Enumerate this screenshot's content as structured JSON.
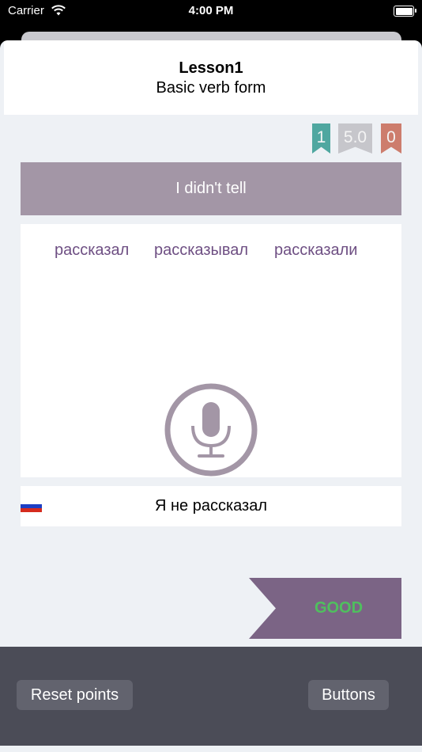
{
  "status_bar": {
    "carrier": "Carrier",
    "time": "4:00 PM"
  },
  "header": {
    "title": "Lesson1",
    "subtitle": "Basic verb form"
  },
  "scores": {
    "correct": "1",
    "rating": "5.0",
    "wrong": "0"
  },
  "prompt": {
    "text": "I didn't tell"
  },
  "choices": [
    "рассказал",
    "рассказывал",
    "рассказали"
  ],
  "translation": {
    "flag": "russia-flag",
    "text": "Я не рассказал"
  },
  "feedback": {
    "label": "GOOD"
  },
  "footer": {
    "reset_label": "Reset points",
    "buttons_label": "Buttons"
  },
  "icons": {
    "microphone": "microphone-icon",
    "wifi": "wifi-icon",
    "battery": "battery-icon"
  },
  "colors": {
    "accent": "#7b6485",
    "prompt_bg": "#a396a6",
    "correct_ribbon": "#4fa7a0",
    "wrong_ribbon": "#cd7d6d",
    "good_text": "#4fc05e",
    "footer_bg": "#4b4c57"
  }
}
